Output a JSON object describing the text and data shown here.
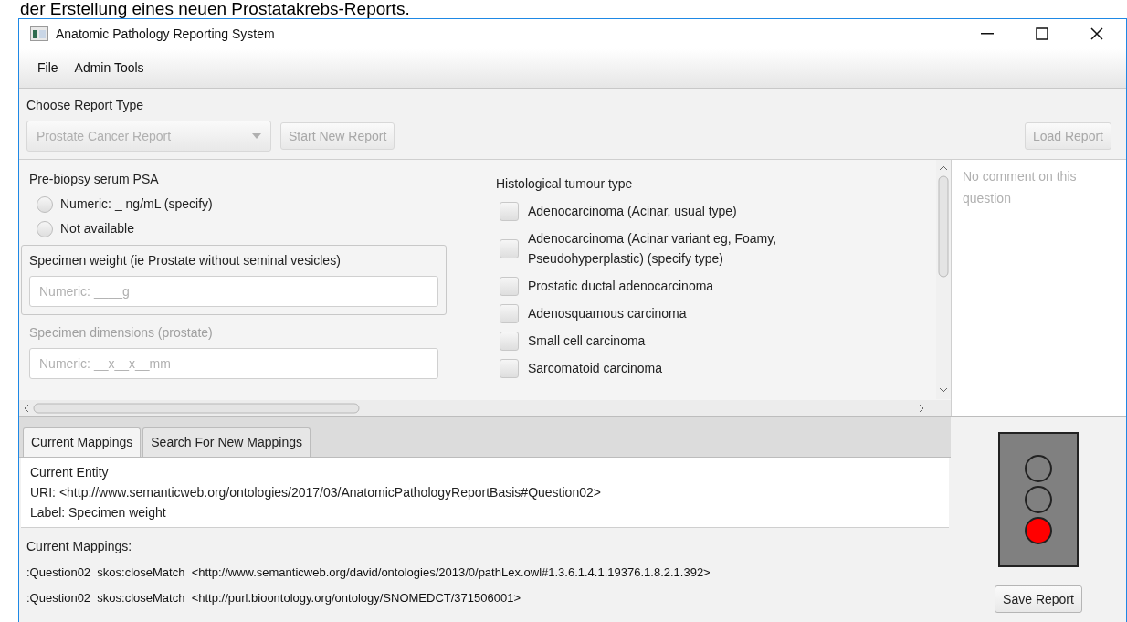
{
  "caption": "der Erstellung eines neuen Prostatakrebs-Reports.",
  "window": {
    "title": "Anatomic Pathology Reporting System"
  },
  "menu": [
    "File",
    "Admin Tools"
  ],
  "report_type": {
    "label": "Choose Report Type",
    "dropdown": {
      "value": "Prostate Cancer Report",
      "disabled": true
    },
    "start_button": {
      "label": "Start New Report",
      "disabled": true
    },
    "load_button": {
      "label": "Load Report",
      "disabled": true
    }
  },
  "questions_left": [
    {
      "kind": "radio",
      "label": "Pre-biopsy serum PSA",
      "selected": false,
      "disabled": false,
      "options": [
        {
          "label": "Numeric: _ ng/mL (specify)",
          "selected": false
        },
        {
          "label": "Not available",
          "selected": false
        }
      ]
    },
    {
      "kind": "text",
      "label": "Specimen weight (ie Prostate without seminal vesicles)",
      "selected": true,
      "disabled": false,
      "placeholder": "Numeric: ____g"
    },
    {
      "kind": "text",
      "label": "Specimen dimensions (prostate)",
      "selected": false,
      "disabled": true,
      "placeholder": "Numeric: __x__x__mm"
    }
  ],
  "question_right": {
    "label": "Histological tumour type",
    "options": [
      {
        "label": "Adenocarcinoma (Acinar, usual type)",
        "checked": false
      },
      {
        "label": "Adenocarcinoma (Acinar variant eg, Foamy, Pseudohyperplastic) (specify type)",
        "checked": false
      },
      {
        "label": "Prostatic ductal adenocarcinoma",
        "checked": false
      },
      {
        "label": "Adenosquamous carcinoma",
        "checked": false
      },
      {
        "label": "Small cell carcinoma",
        "checked": false
      },
      {
        "label": "Sarcomatoid carcinoma",
        "checked": false
      }
    ]
  },
  "comment": {
    "placeholder": "No comment on this question"
  },
  "tabs": [
    {
      "label": "Current Mappings",
      "selected": true
    },
    {
      "label": "Search For New Mappings",
      "selected": false
    }
  ],
  "entity": {
    "heading": "Current Entity",
    "uri": "URI: <http://www.semanticweb.org/ontologies/2017/03/AnatomicPathologyReportBasis#Question02>",
    "label": "Label: Specimen weight"
  },
  "mappings": {
    "heading": "Current Mappings:",
    "rows": [
      ":Question02  skos:closeMatch  <http://www.semanticweb.org/david/ontologies/2013/0/pathLex.owl#1.3.6.1.4.1.19376.1.8.2.1.392>",
      ":Question02  skos:closeMatch  <http://purl.bioontology.org/ontology/SNOMEDCT/371506001>"
    ]
  },
  "status_light": {
    "lights": [
      {
        "color": "#808080"
      },
      {
        "color": "#808080"
      },
      {
        "color": "#ff0000"
      }
    ]
  },
  "save_button": {
    "label": "Save Report",
    "disabled": false
  }
}
